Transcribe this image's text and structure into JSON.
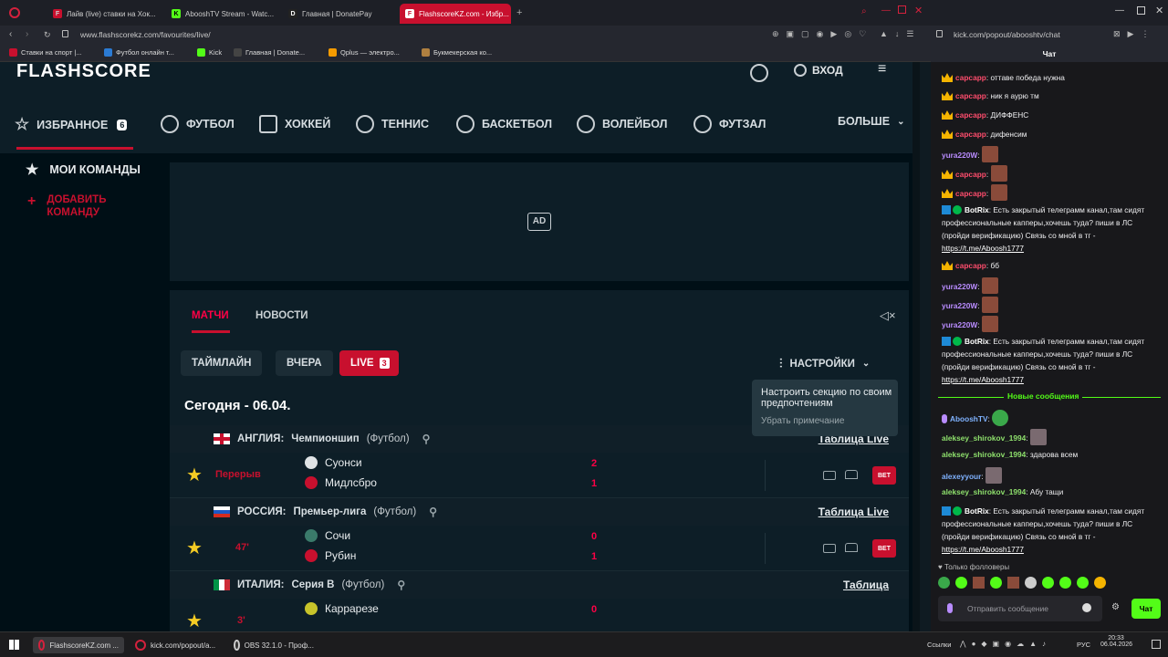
{
  "browser": {
    "tabs": [
      {
        "label": "Лайв (live) ставки на Хок...",
        "active": false
      },
      {
        "label": "AbooshTV Stream - Watc...",
        "active": false
      },
      {
        "label": "Главная | DonatePay",
        "active": false
      },
      {
        "label": "FlashscoreKZ.com - Избр...",
        "active": true
      }
    ],
    "url": "www.flashscorekz.com/favourites/live/",
    "popup_url": "kick.com/popout/abooshtv/chat",
    "popup_title": "Чат",
    "bookmarks": [
      "Ставки на спорт |...",
      "Футбол онлайн т...",
      "Kick",
      "Главная | Donate...",
      "Qplus — электро...",
      "Букмекерская ко..."
    ]
  },
  "site": {
    "logo": "FLASHSCORE",
    "login": "ВХОД",
    "nav": [
      {
        "label": "ИЗБРАННОЕ",
        "badge": "6"
      },
      {
        "label": "ФУТБОЛ"
      },
      {
        "label": "ХОККЕЙ"
      },
      {
        "label": "ТЕННИС"
      },
      {
        "label": "БАСКЕТБОЛ"
      },
      {
        "label": "ВОЛЕЙБОЛ"
      },
      {
        "label": "ФУТЗАЛ"
      }
    ],
    "more": "БОЛЬШЕ",
    "my_teams": "МОИ КОМАНДЫ",
    "add_team": "ДОБАВИТЬ КОМАНДУ",
    "ad": "AD",
    "tabs": [
      "МАТЧИ",
      "НОВОСТИ"
    ],
    "filters": {
      "timeline": "ТАЙМЛАЙН",
      "yesterday": "ВЧЕРА",
      "live": "LIVE",
      "live_count": "3"
    },
    "settings": "НАСТРОЙКИ",
    "tooltip": {
      "text": "Настроить секцию по своим предпочтениям",
      "dismiss": "Убрать примечание"
    },
    "date": "Сегодня - 06.04.",
    "leagues": [
      {
        "country": "АНГЛИЯ:",
        "name": "Чемпионшип",
        "sport": "(Футбол)",
        "link": "Таблица Live",
        "match": {
          "stage": "Перерыв",
          "home": "Суонси",
          "away": "Мидлсбро",
          "home_score": "2",
          "away_score": "1"
        }
      },
      {
        "country": "РОССИЯ:",
        "name": "Премьер-лига",
        "sport": "(Футбол)",
        "link": "Таблица Live",
        "match": {
          "stage": "47'",
          "home": "Сочи",
          "away": "Рубин",
          "home_score": "0",
          "away_score": "1"
        }
      },
      {
        "country": "ИТАЛИЯ:",
        "name": "Серия B",
        "sport": "(Футбол)",
        "link": "Таблица",
        "match": {
          "stage": "3'",
          "home": "Каррарезе",
          "away": "",
          "home_score": "0",
          "away_score": ""
        }
      }
    ],
    "bet_label": "BET"
  },
  "chat": {
    "messages": [
      {
        "user": "сарсарр",
        "text": "оттаве победа нужна"
      },
      {
        "user": "сарсарр",
        "text": "ник я аурю тм"
      },
      {
        "user": "сарсарр",
        "text": "ДИФФЕНС"
      },
      {
        "user": "сарсарр",
        "text": "дифенсим"
      },
      {
        "user": "yura220W",
        "text": ""
      },
      {
        "user": "сарсарр",
        "text": ""
      },
      {
        "user": "сарсарр",
        "text": ""
      },
      {
        "user": "BotRix",
        "text": "Есть закрытый телеграмм канал,там сидят профессиональные капперы,хочешь туда? пиши в ЛС (пройди верификацию) Связь со мной в тг -",
        "link": "https://t.me/Aboosh1777"
      },
      {
        "user": "сарсарр",
        "text": "бб"
      },
      {
        "user": "yura220W",
        "text": ""
      },
      {
        "user": "yura220W",
        "text": ""
      },
      {
        "user": "yura220W",
        "text": ""
      },
      {
        "user": "BotRix",
        "text": "Есть закрытый телеграмм канал,там сидят профессиональные капперы,хочешь туда? пиши в ЛС (пройди верификацию) Связь со мной в тг -",
        "link": "https://t.me/Aboosh1777"
      }
    ],
    "new_messages": "Новые сообщения",
    "messages2": [
      {
        "user": "AbooshTV",
        "text": ""
      },
      {
        "user": "aleksey_shirokov_1994",
        "text": ""
      },
      {
        "user": "aleksey_shirokov_1994",
        "text": "здарова всем"
      },
      {
        "user": "alexeyyour",
        "text": ""
      },
      {
        "user": "aleksey_shirokov_1994",
        "text": "Абу тащи"
      },
      {
        "user": "BotRix",
        "text": "Есть закрытый телеграмм канал,там сидят профессиональные капперы,хочешь туда? пиши в ЛС (пройди верификацию) Связь со мной в тг -",
        "link": "https://t.me/Aboosh1777"
      }
    ],
    "followers_only": "Только фолловеры",
    "input_placeholder": "Отправить сообщение",
    "send": "Чат"
  },
  "taskbar": {
    "apps": [
      "FlashscoreKZ.com ...",
      "kick.com/popout/a...",
      "OBS 32.1.0 - Проф..."
    ],
    "links": "Ссылки",
    "lang": "РУС",
    "time": "20:33",
    "date": "06.04.2026"
  }
}
